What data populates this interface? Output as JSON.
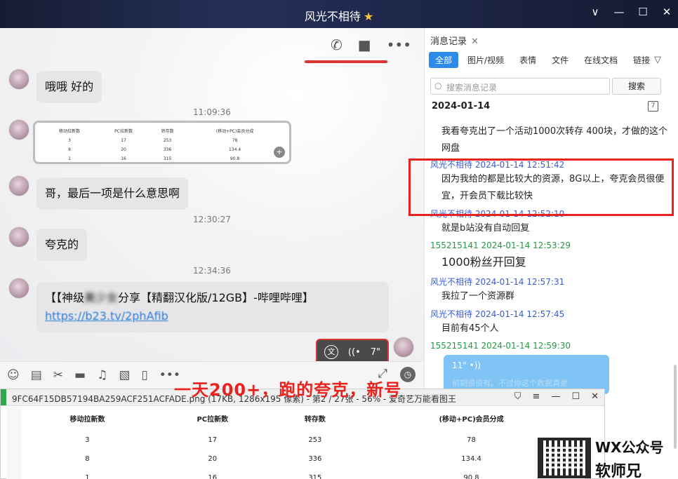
{
  "window": {
    "title": "风光不相待",
    "controls": [
      "∨",
      "—",
      "☐",
      "✕"
    ]
  },
  "chat": {
    "messages": [
      {
        "text": "哦哦 好的"
      },
      {
        "timestamp": "11:09:36"
      },
      {
        "text": "哥，最后一项是什么意思啊"
      },
      {
        "timestamp": "12:30:27"
      },
      {
        "text": "夸克的"
      },
      {
        "timestamp": "12:34:36"
      },
      {
        "text_part1": "【【神级",
        "text_part2": "美少女",
        "text_part3": "分享【精翻汉化版/12GB】-哔哩哔哩】",
        "link": "https://b23.tv/2phAfib"
      }
    ],
    "image_table": {
      "headers": [
        "移动拉新数",
        "PC拉新数",
        "转存数",
        "(移动+PC)会员分成"
      ],
      "rows": [
        [
          "3",
          "17",
          "253",
          "78"
        ],
        [
          "8",
          "20",
          "336",
          "134.4"
        ],
        [
          "1",
          "16",
          "315",
          "90.8"
        ]
      ]
    },
    "voice_duration": "7\"",
    "voice_to_text": "文"
  },
  "caption": "一天200+，跑的夸克，新号",
  "history": {
    "header": "消息记录",
    "tabs": [
      "全部",
      "图片/视频",
      "表情",
      "文件",
      "在线文档",
      "链接"
    ],
    "search_placeholder": "搜索消息记录",
    "search_button": "搜索",
    "date": "2024-01-14",
    "calendar_day": "7",
    "entries": [
      {
        "text": "我看夸克出了一个活动1000次转存 400块，才做的这个网盘"
      },
      {
        "sender": "风光不相待 2024-01-14 12:51:42"
      },
      {
        "text": "因为我给的都是比较大的资源，8G以上，夸克会员很便宜，开会员下载比较快"
      },
      {
        "sender": "风光不相待 2024-01-14 12:52:10"
      },
      {
        "text": "就是b站没有自动回复"
      },
      {
        "sender": "155215141 2024-01-14 12:53:29"
      },
      {
        "text": "1000粉丝开回复"
      },
      {
        "sender": "风光不相待 2024-01-14 12:57:31"
      },
      {
        "text": "我拉了一个资源群"
      },
      {
        "sender": "风光不相待 2024-01-14 12:57:45"
      },
      {
        "text": "目前有45个人"
      },
      {
        "sender": "155215141 2024-01-14 12:59:30"
      }
    ],
    "my_voice": "11\"",
    "my_voice_note": "前期很很有。不过你这个数据真是"
  },
  "viewer": {
    "title": "9FC64F15DB57194BA259ACF251ACFADE.png (17KB, 1286x195 像素) - 第2 / 27张 - 56% - 爱奇艺万能看图王",
    "headers": [
      "移动拉新数",
      "PC拉新数",
      "转存数",
      "(移动+PC)会员分成"
    ],
    "rows": [
      [
        "3",
        "17",
        "253",
        "78"
      ],
      [
        "8",
        "20",
        "336",
        "134.4"
      ],
      [
        "1",
        "16",
        "315",
        "90.8"
      ]
    ]
  },
  "watermark": {
    "line1": "WX公众号",
    "line2": "软师兄"
  }
}
